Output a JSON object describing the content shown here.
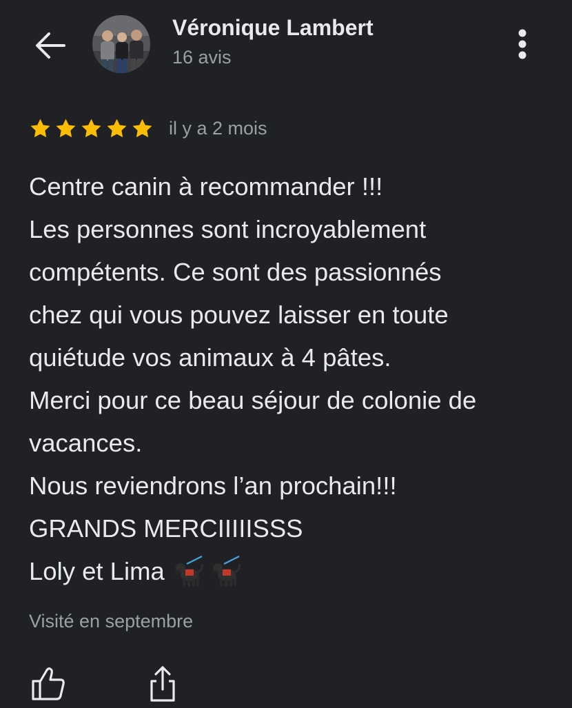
{
  "header": {
    "author_name": "Véronique Lambert",
    "review_count": "16 avis",
    "icons": {
      "back": "arrow-left-icon",
      "avatar": "profile-photo",
      "menu": "more-vert-icon"
    }
  },
  "review": {
    "rating": 5,
    "rating_max": 5,
    "star_color": "#fbbc04",
    "date": "il y a 2 mois",
    "lines": [
      "Centre canin à recommander !!!",
      "Les personnes sont incroyablement",
      "compétents. Ce sont des passionnés",
      "chez qui vous pouvez laisser en toute",
      "quiétude vos animaux à 4 pâtes.",
      "Merci pour ce beau séjour de colonie de",
      "vacances.",
      "Nous reviendrons l’an prochain!!!",
      "GRANDS MERCIIIIISSS",
      "Loly et Lima"
    ],
    "trailing_emojis": [
      "service-dog-emoji",
      "service-dog-emoji"
    ],
    "visited": "Visité en septembre"
  },
  "actions": {
    "like_icon": "thumb-up-icon",
    "share_icon": "share-icon"
  }
}
